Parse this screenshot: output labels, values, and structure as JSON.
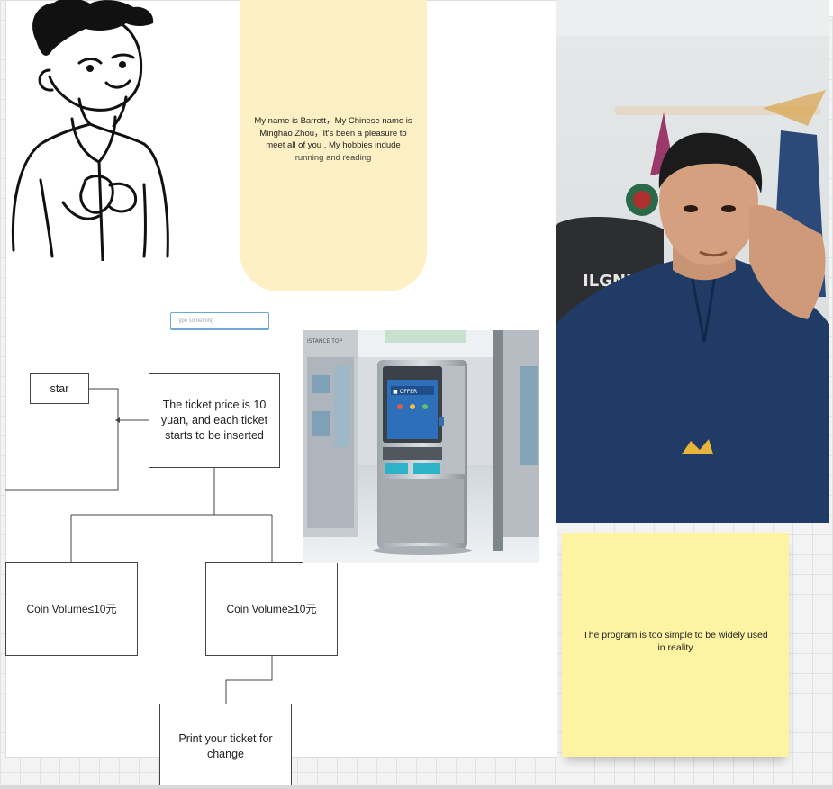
{
  "bio_card": {
    "line1": "My name is Barrett，My Chinese name is",
    "line2": "Minghao Zhou，It's been a pleasure to",
    "line3": "meet all of you , My hobbies indude",
    "line4": "running and reading"
  },
  "input": {
    "placeholder": "Type something"
  },
  "flowchart": {
    "start": "star",
    "ticket": "The ticket price is 10 yuan, and each ticket starts to be inserted",
    "coin_low": "Coin Volume≤10元",
    "coin_high": "Coin Volume≥10元",
    "print": "Print your ticket for change"
  },
  "kiosk_image": {
    "sign_text": "ISTANCE TOP",
    "screen_text": "■ OFFER"
  },
  "photo": {
    "chair_text": "ILGNIT"
  },
  "sticky_note": {
    "text": "The program is too simple to be widely used in reality"
  },
  "colors": {
    "bio_card": "#fdf0c4",
    "sticky": "#fdf3a2",
    "input_border": "#6fa6d8"
  }
}
